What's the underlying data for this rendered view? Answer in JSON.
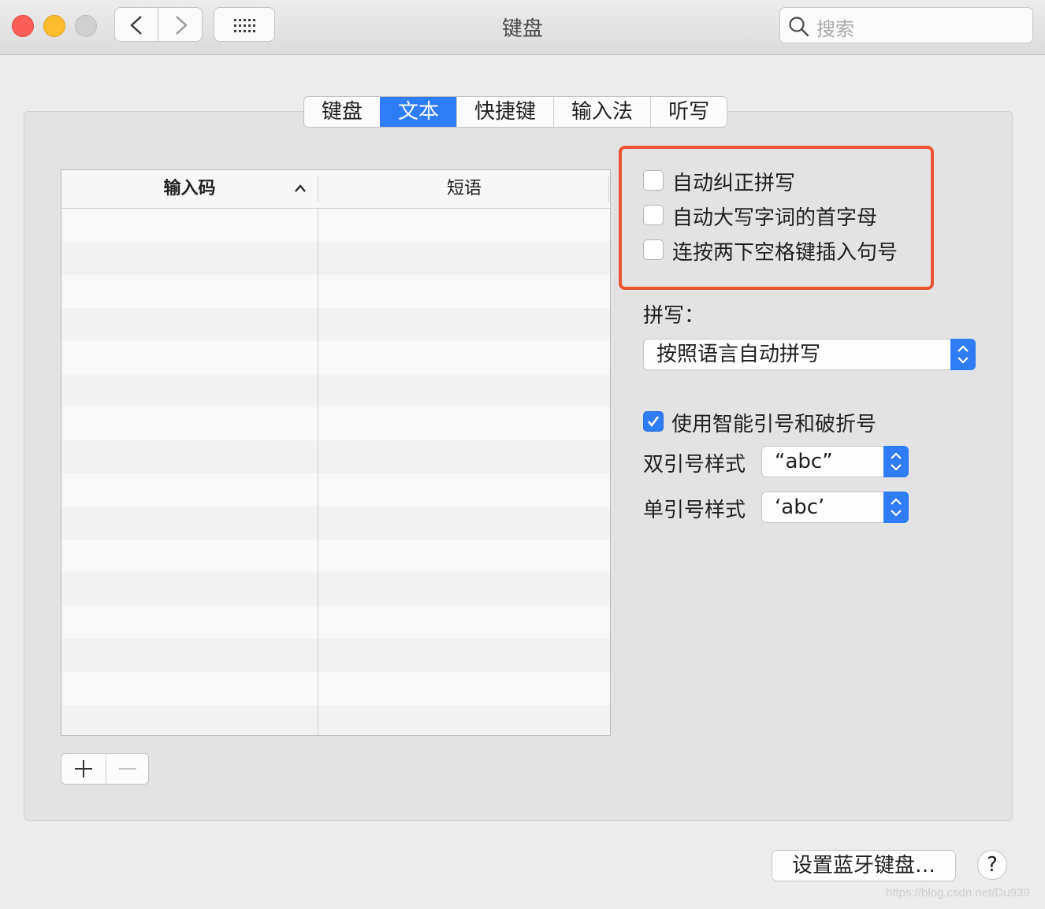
{
  "window": {
    "title": "键盘",
    "search_placeholder": "搜索"
  },
  "tabs": [
    {
      "label": "键盘",
      "active": false
    },
    {
      "label": "文本",
      "active": true
    },
    {
      "label": "快捷键",
      "active": false
    },
    {
      "label": "输入法",
      "active": false
    },
    {
      "label": "听写",
      "active": false
    }
  ],
  "table": {
    "col_input": "输入码",
    "col_phrase": "短语",
    "rows": []
  },
  "options": {
    "auto_correct": {
      "label": "自动纠正拼写",
      "checked": false
    },
    "auto_capitalize": {
      "label": "自动大写字词的首字母",
      "checked": false
    },
    "double_space_period": {
      "label": "连按两下空格键插入句号",
      "checked": false
    },
    "spelling_label": "拼写：",
    "spelling_value": "按照语言自动拼写",
    "smart_quotes": {
      "label": "使用智能引号和破折号",
      "checked": true
    },
    "double_quote_label": "双引号样式",
    "double_quote_value": "“abc”",
    "single_quote_label": "单引号样式",
    "single_quote_value": "‘abc’"
  },
  "footer": {
    "bluetooth_button": "设置蓝牙键盘…",
    "help_label": "?",
    "watermark": "https://blog.csdn.net/Du939"
  },
  "colors": {
    "accent": "#2e7cf6",
    "highlight_border": "#ea5530"
  }
}
